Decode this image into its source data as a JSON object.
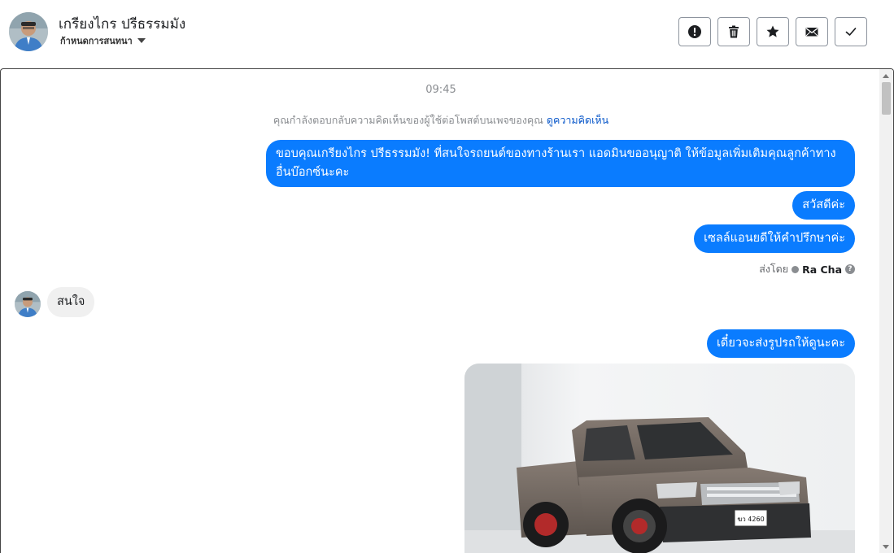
{
  "header": {
    "name": "เกรียงไกร ปรีธรรมมัง",
    "subtitle": "ก้าหนดการสนทนา"
  },
  "actions": [
    {
      "name": "report",
      "icon": "exclamation-circle-icon"
    },
    {
      "name": "delete",
      "icon": "trash-icon"
    },
    {
      "name": "star",
      "icon": "star-icon"
    },
    {
      "name": "mail",
      "icon": "envelope-icon"
    },
    {
      "name": "done",
      "icon": "check-icon"
    }
  ],
  "conversation": {
    "time": "09:45",
    "reply_note": "คุณกำลังตอบกลับความคิดเห็นของผู้ใช้ต่อโพสต์บนเพจของคุณ",
    "reply_link": "ดูความคิดเห็น",
    "messages": [
      {
        "from": "page",
        "text": "ขอบคุณเกรียงไกร ปรีธรรมมัง! ที่สนใจรถยนต์ของทางร้านเรา แอดมินขออนุญาติ ให้ข้อมูลเพิ่มเติมคุณลูกค้าทางอื่นบ๊อกซ์นะคะ"
      },
      {
        "from": "page",
        "text": "สวัสดีค่ะ"
      },
      {
        "from": "page",
        "text": "เซลล์แอนยดีให้คำปรึกษาค่ะ"
      },
      {
        "from": "user",
        "text": "สนใจ"
      },
      {
        "from": "page",
        "text": "เดี๋ยวจะส่งรูปรถให้ดูนะคะ"
      }
    ],
    "sent_by_label": "ส่งโดย",
    "sent_by_agent": "Ra Cha",
    "help_glyph": "?",
    "plate": "ฆว 4260"
  },
  "colors": {
    "outgoing_bubble": "#0a7cff",
    "incoming_bubble": "#f0f0f0",
    "link": "#0a58ca"
  }
}
